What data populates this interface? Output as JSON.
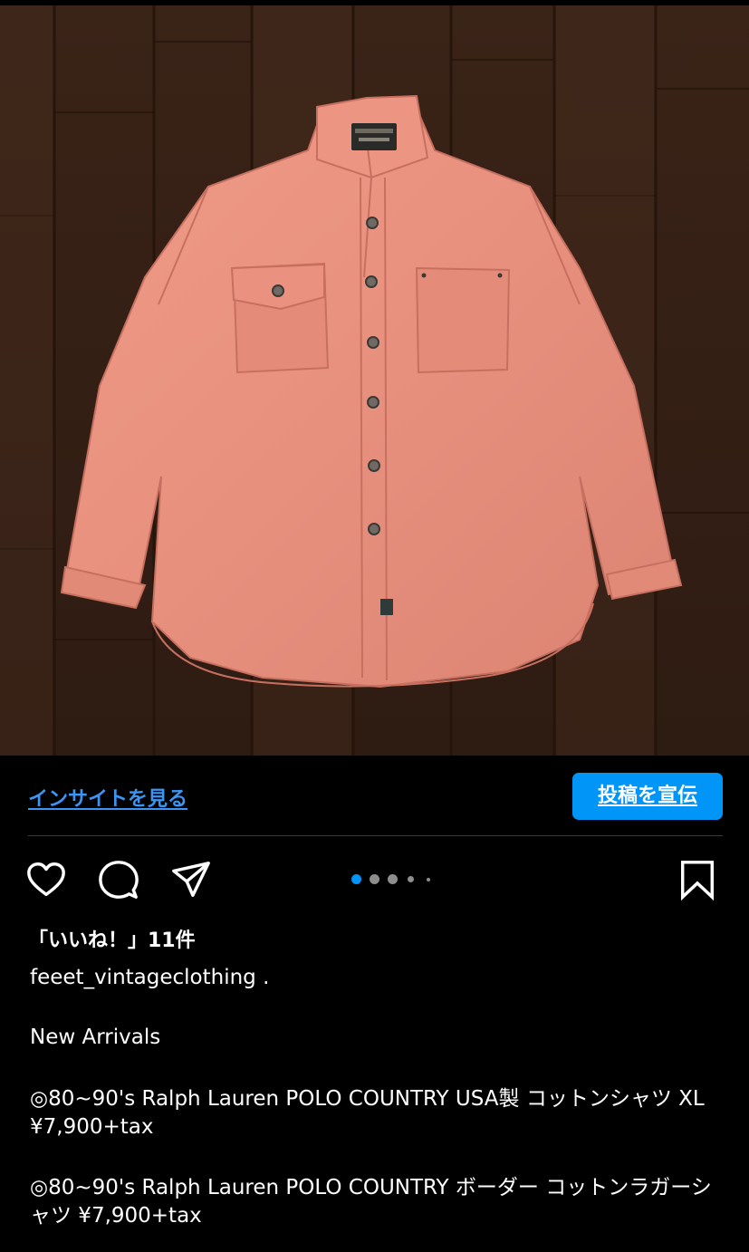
{
  "post": {
    "image_alt": "salmon-pink button-up cotton shirt on wooden floor",
    "colors": {
      "shirt": "#e89383",
      "floor": "#3d2518",
      "accent_blue": "#0095f6",
      "link_blue": "#3b95f5"
    }
  },
  "insights": {
    "link_label": "インサイトを見る",
    "promote_label": "投稿を宣伝"
  },
  "actions": {
    "like_icon": "heart-icon",
    "comment_icon": "comment-bubble-icon",
    "share_icon": "paper-plane-icon",
    "save_icon": "bookmark-icon",
    "carousel_total_visible": 5,
    "carousel_active_index": 0
  },
  "likes": {
    "text": "「いいね！」11件"
  },
  "caption": {
    "username": "feeet_vintageclothing",
    "first_line_suffix": " .",
    "lines": [
      "New Arrivals",
      "◎80~90's Ralph Lauren POLO COUNTRY USA製 コットンシャツ XL ¥7,900+tax",
      "◎80~90's Ralph Lauren POLO COUNTRY ボーダー コットンラガーシャツ ¥7,900+tax"
    ]
  }
}
